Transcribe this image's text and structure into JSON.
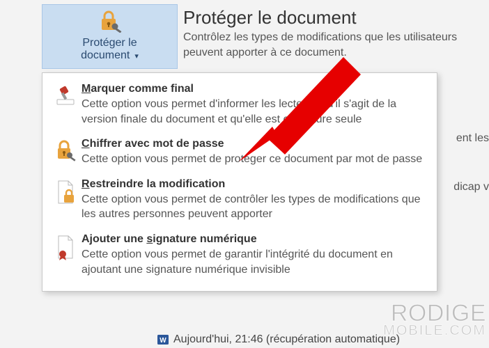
{
  "header": {
    "title": "Protéger le document",
    "subtitle": "Contrôlez les types de modifications que les utilisateurs peuvent apporter à ce document."
  },
  "button": {
    "line1": "Protéger le",
    "line2": "document"
  },
  "background": {
    "line1": "ent les",
    "line2": "dicap v"
  },
  "menu": {
    "mark_final": {
      "title_pre": "M",
      "title_rest": "arquer comme final",
      "desc": "Cette option vous permet d'informer les lecteurs qu'il s'agit de la version finale du document et qu'elle est en lecture seule"
    },
    "encrypt": {
      "title_pre": "C",
      "title_rest": "hiffrer avec mot de passe",
      "desc": "Cette option vous permet de protéger ce document par mot de passe"
    },
    "restrict": {
      "title_pre": "R",
      "title_rest": "estreindre la modification",
      "desc": "Cette option vous permet de contrôler les types de modifications que les autres personnes peuvent apporter"
    },
    "signature": {
      "title": "Ajouter une signature numérique",
      "title_ul": "s",
      "desc": "Cette option vous permet de garantir l'intégrité du document en ajoutant une signature numérique invisible"
    }
  },
  "footer": {
    "text": "Aujourd'hui, 21:46 (récupération automatique)"
  },
  "watermark": {
    "main": "RODIGE",
    "sub": "MOBILE.COM"
  }
}
